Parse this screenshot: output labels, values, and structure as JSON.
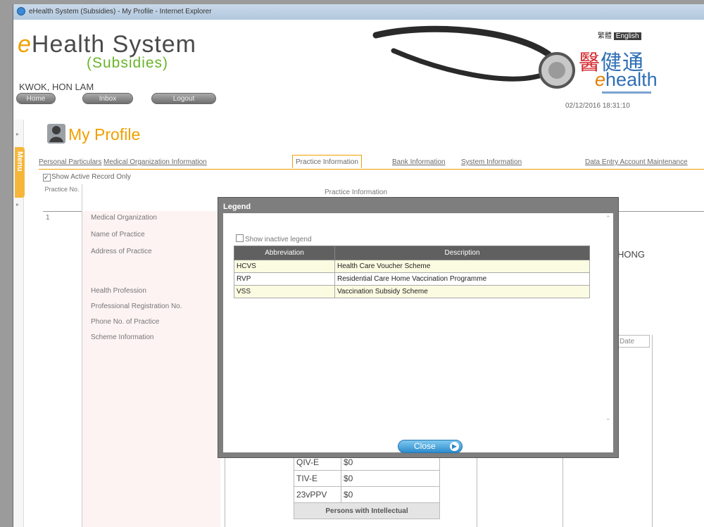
{
  "window": {
    "title": "eHealth System (Subsidies) - My Profile - Internet Explorer"
  },
  "header": {
    "logo_main": "Health System",
    "logo_e": "e",
    "logo_sub": "(Subsidies)",
    "username": "KWOK, HON LAM",
    "nav": [
      "Home",
      "Inbox",
      "Logout"
    ],
    "lang_cn": "繁體",
    "lang_en": "English",
    "brand_cn": "醫健通",
    "brand_e": "e",
    "brand_health": "health",
    "datetime": "02/12/2016 18:31:10"
  },
  "menu": {
    "label": "Menu"
  },
  "page": {
    "title": "My Profile"
  },
  "tabs": [
    "Personal Particulars",
    "Medical Organization Information",
    "Practice Information",
    "Bank Information",
    "System Information",
    "Data Entry Account Maintenance"
  ],
  "active_tab": "Practice Information",
  "filter": {
    "show_active_label": "Show Active Record Only",
    "checked": true
  },
  "table": {
    "col_practice_no": "Practice No.",
    "col_practice_info": "Practice Information",
    "row_no": "1",
    "fields": [
      "Medical Organization",
      "Name of Practice",
      "Address of Practice",
      "Health Profession",
      "Professional Registration No.",
      "Phone No. of Practice",
      "Scheme Information"
    ],
    "address_tail": "HONG",
    "date_header": "Date",
    "subsidy_rows": [
      {
        "name": "QIV-E",
        "value": "$0"
      },
      {
        "name": "TIV-E",
        "value": "$0"
      },
      {
        "name": "23vPPV",
        "value": "$0"
      }
    ],
    "subsidy_footer": "Persons with Intellectual"
  },
  "legend_dialog": {
    "title": "Legend",
    "show_inactive_label": "Show inactive legend",
    "headers": [
      "Abbreviation",
      "Description"
    ],
    "rows": [
      {
        "abbr": "HCVS",
        "desc": "Health Care Voucher Scheme"
      },
      {
        "abbr": "RVP",
        "desc": "Residential Care Home Vaccination Programme"
      },
      {
        "abbr": "VSS",
        "desc": "Vaccination Subsidy Scheme"
      }
    ],
    "close_label": "Close"
  }
}
